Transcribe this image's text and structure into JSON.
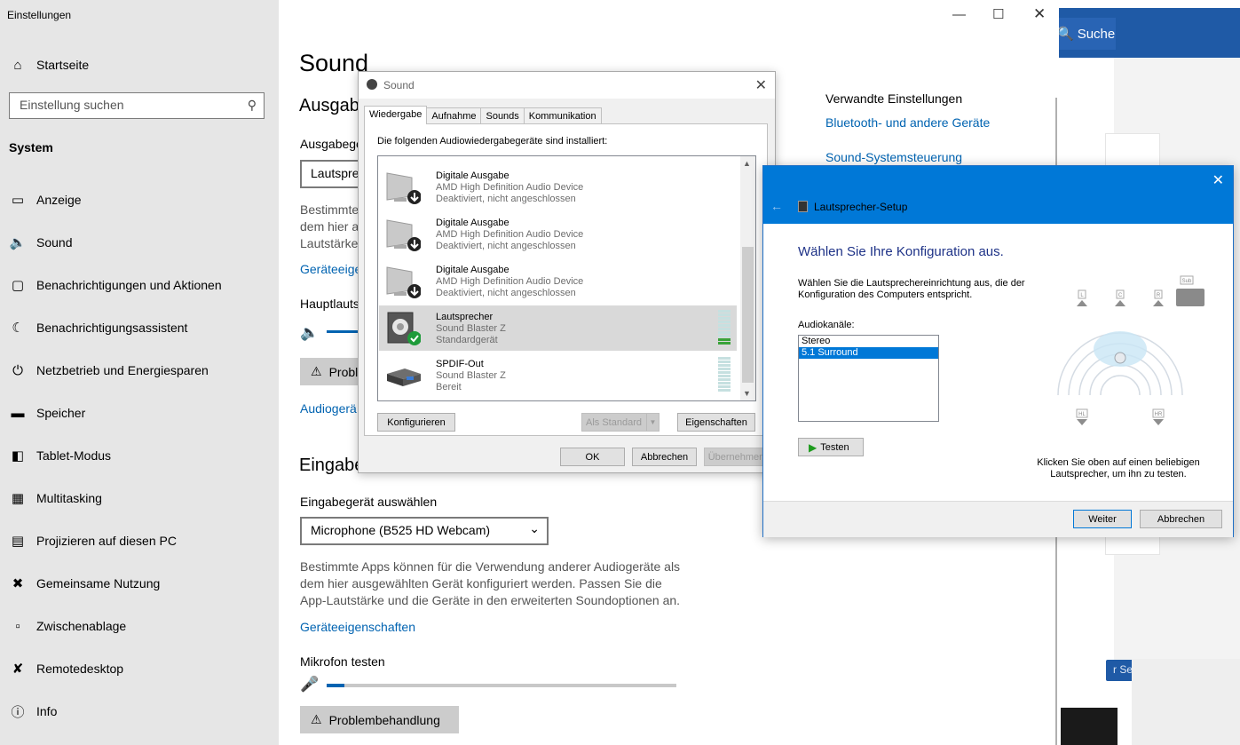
{
  "browser": {
    "search_label": "Suche",
    "chip_label": "r Senau"
  },
  "settings": {
    "window_title": "Einstellungen",
    "home_label": "Startseite",
    "search_placeholder": "Einstellung suchen",
    "group_label": "System",
    "nav_items": [
      {
        "label": "Anzeige",
        "icon": "monitor-icon"
      },
      {
        "label": "Sound",
        "icon": "speaker-icon"
      },
      {
        "label": "Benachrichtigungen und Aktionen",
        "icon": "notification-icon"
      },
      {
        "label": "Benachrichtigungsassistent",
        "icon": "moon-icon"
      },
      {
        "label": "Netzbetrieb und Energiesparen",
        "icon": "power-icon"
      },
      {
        "label": "Speicher",
        "icon": "storage-icon"
      },
      {
        "label": "Tablet-Modus",
        "icon": "tablet-icon"
      },
      {
        "label": "Multitasking",
        "icon": "multitasking-icon"
      },
      {
        "label": "Projizieren auf diesen PC",
        "icon": "project-icon"
      },
      {
        "label": "Gemeinsame Nutzung",
        "icon": "share-icon"
      },
      {
        "label": "Zwischenablage",
        "icon": "clipboard-icon"
      },
      {
        "label": "Remotedesktop",
        "icon": "remote-icon"
      },
      {
        "label": "Info",
        "icon": "info-icon"
      }
    ],
    "page_title": "Sound",
    "output_heading": "Ausgab",
    "output_select_label": "Ausgabege",
    "output_select_value": "Lautspre",
    "output_desc_lines": [
      "Bestimmte",
      "dem hier a",
      "Lautstärke"
    ],
    "output_props_link": "Geräteeigen",
    "master_volume_label": "Hauptlauts",
    "output_troubleshoot": "Probl",
    "audio_link": "Audiogerä",
    "input_heading": "Eingabe",
    "input_select_label": "Eingabegerät auswählen",
    "input_select_value": "Microphone (B525 HD Webcam)",
    "input_desc": "Bestimmte Apps können für die Verwendung anderer Audiogeräte als dem hier ausgewählten Gerät konfiguriert werden. Passen Sie die App-Lautstärke und die Geräte in den erweiterten Soundoptionen an.",
    "input_props_link": "Geräteeigenschaften",
    "mic_test_label": "Mikrofon testen",
    "mic_level": 0.05,
    "troubleshoot_label": "Problembehandlung",
    "related_title": "Verwandte Einstellungen",
    "related_links": [
      "Bluetooth- und andere Geräte",
      "Sound-Systemsteuerung"
    ]
  },
  "sound_dialog": {
    "title": "Sound",
    "tabs": [
      "Wiedergabe",
      "Aufnahme",
      "Sounds",
      "Kommunikation"
    ],
    "intro": "Die folgenden Audiowiedergabegeräte sind installiert:",
    "devices": [
      {
        "name": "Digitale Ausgabe",
        "driver": "AMD High Definition Audio Device",
        "status": "Deaktiviert, nicht angeschlossen"
      },
      {
        "name": "Digitale Ausgabe",
        "driver": "AMD High Definition Audio Device",
        "status": "Deaktiviert, nicht angeschlossen"
      },
      {
        "name": "Digitale Ausgabe",
        "driver": "AMD High Definition Audio Device",
        "status": "Deaktiviert, nicht angeschlossen"
      },
      {
        "name": "Lautsprecher",
        "driver": "Sound Blaster Z",
        "status": "Standardgerät"
      },
      {
        "name": "SPDIF-Out",
        "driver": "Sound Blaster Z",
        "status": "Bereit"
      }
    ],
    "configure": "Konfigurieren",
    "set_default": "Als Standard",
    "properties": "Eigenschaften",
    "ok": "OK",
    "cancel": "Abbrechen",
    "apply": "Übernehmen"
  },
  "setup": {
    "title": "Lautsprecher-Setup",
    "heading": "Wählen Sie Ihre Konfiguration aus.",
    "description": "Wählen Sie die Lautsprechereinrichtung aus, die der Konfiguration des Computers entspricht.",
    "channels_label": "Audiokanäle:",
    "options": [
      "Stereo",
      "5.1 Surround"
    ],
    "selected": "5.1 Surround",
    "test": "Testen",
    "hint": "Klicken Sie oben auf einen beliebigen Lautsprecher, um ihn zu testen.",
    "speaker_labels": [
      "L",
      "C",
      "R",
      "Sub",
      "HL",
      "HR"
    ],
    "next": "Weiter",
    "cancel": "Abbrechen"
  }
}
